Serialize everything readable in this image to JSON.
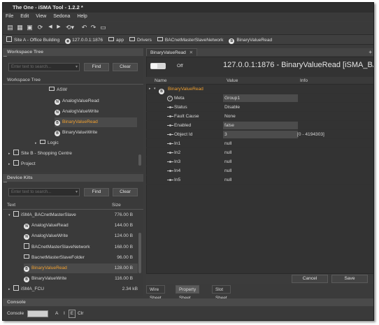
{
  "window": {
    "title": "The One - iSMA Tool - 1.2.2 *"
  },
  "menu": [
    "File",
    "Edit",
    "View",
    "Sedona",
    "Help"
  ],
  "breadcrumb": [
    "Site A - Office Building",
    "127.0.0.1:1876",
    "app",
    "Drivers",
    "BACnetMasterSlaveNetwork",
    "BinaryValueRead"
  ],
  "workspace_tree": {
    "title": "Workspace Tree",
    "search_placeholder": "Enter text to search...",
    "find_label": "Find",
    "clear_label": "Clear",
    "header": "Workspace Tree",
    "items": [
      {
        "label": "ASW",
        "icon": "folder-icon"
      },
      {
        "label": "AnalogValueRead",
        "icon": "component-n-icon"
      },
      {
        "label": "AnalogValueWrite",
        "icon": "component-n-icon"
      },
      {
        "label": "BinaryValueRead",
        "icon": "component-b-icon",
        "selected": true
      },
      {
        "label": "BinaryValueWrite",
        "icon": "component-b-icon"
      },
      {
        "label": "Logic",
        "icon": "folder-icon"
      },
      {
        "label": "Site B - Shopping Centre",
        "icon": "site-icon"
      },
      {
        "label": "Project",
        "icon": "project-icon"
      }
    ]
  },
  "device_kits": {
    "title": "Device Kits",
    "search_placeholder": "Enter text to search...",
    "find_label": "Find",
    "clear_label": "Clear",
    "col_text": "Text",
    "col_size": "Size",
    "items": [
      {
        "label": "iSMA_BACnetMasterSlave",
        "size": "776.00 B"
      },
      {
        "label": "AnalogValueRead",
        "size": "144.00 B"
      },
      {
        "label": "AnalogValueWrite",
        "size": "124.00 B"
      },
      {
        "label": "BACnetMasterSlaveNetwork",
        "size": "168.00 B"
      },
      {
        "label": "BacnetMasterSlaveFolder",
        "size": "96.00 B"
      },
      {
        "label": "BinaryValueRead",
        "size": "128.00 B",
        "selected": true
      },
      {
        "label": "BinaryValueWrite",
        "size": "116.00 B"
      },
      {
        "label": "iSMA_FCU",
        "size": "2.34 kB"
      }
    ]
  },
  "editor": {
    "tab": "BinaryValueRead",
    "toggle_label": "Off",
    "title": "127.0.0.1:1876 - BinaryValueRead [iSMA_BAC",
    "columns": {
      "name": "Name",
      "value": "Value",
      "info": "Info"
    },
    "root": "BinaryValueRead",
    "rows": [
      {
        "name": "Meta",
        "value": "Group1",
        "info": ""
      },
      {
        "name": "Status",
        "value": "Disable",
        "info": ""
      },
      {
        "name": "Fault Cause",
        "value": "None",
        "info": ""
      },
      {
        "name": "Enabled",
        "value": "false",
        "info": ""
      },
      {
        "name": "Object Id",
        "value": "3",
        "info": "[0 - 4194303]"
      },
      {
        "name": "In1",
        "value": "null",
        "info": ""
      },
      {
        "name": "In2",
        "value": "null",
        "info": ""
      },
      {
        "name": "In3",
        "value": "null",
        "info": ""
      },
      {
        "name": "In4",
        "value": "null",
        "info": ""
      },
      {
        "name": "In5",
        "value": "null",
        "info": ""
      }
    ],
    "cancel_label": "Cancel",
    "save_label": "Save",
    "bottom_tabs": [
      "Wire Sheet",
      "Property Sheet",
      "Slot Sheet"
    ]
  },
  "console": {
    "title": "Console",
    "label": "Console",
    "btn_a": "A",
    "btn_i": "I",
    "btn_e": "E",
    "btn_clr": "Clr"
  }
}
